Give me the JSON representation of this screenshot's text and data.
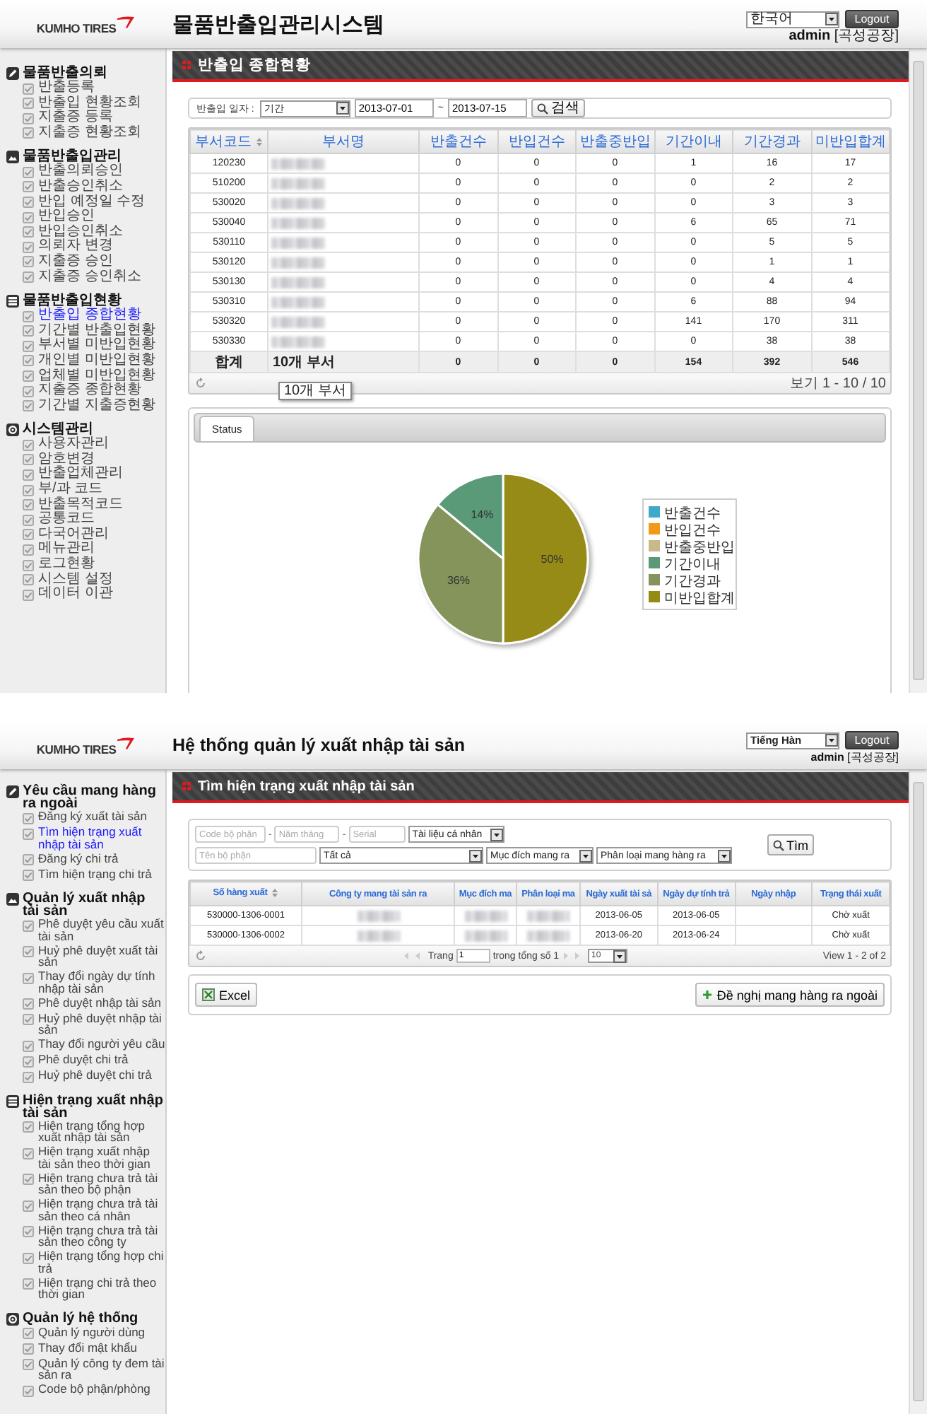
{
  "screens": [
    {
      "kind": "summary",
      "header": {
        "logo": "KUMHO TIRES",
        "title": "물품반출입관리시스템",
        "language": "한국어",
        "logout": "Logout",
        "user": "**admin** [곡성공장]"
      },
      "sidebar": [
        {
          "title": "물품반출의뢰",
          "items": [
            {
              "label": "반출등록",
              "selected": false
            },
            {
              "label": "반출입 현황조회",
              "selected": false
            },
            {
              "label": "지출증 등록",
              "selected": false
            },
            {
              "label": "지출증 현황조회",
              "selected": false
            }
          ]
        },
        {
          "title": "물품반출입관리",
          "items": [
            {
              "label": "반출의뢰승인",
              "selected": false
            },
            {
              "label": "반출승인취소",
              "selected": false
            },
            {
              "label": "반입 예정일 수정",
              "selected": false
            },
            {
              "label": "반입승인",
              "selected": false
            },
            {
              "label": "반입승인취소",
              "selected": false
            },
            {
              "label": "의뢰자 변경",
              "selected": false
            },
            {
              "label": "지출증 승인",
              "selected": false
            },
            {
              "label": "지출증 승인취소",
              "selected": false
            }
          ]
        },
        {
          "title": "물품반출입현황",
          "items": [
            {
              "label": "반출입 종합현황",
              "selected": true
            },
            {
              "label": "기간별 반출입현황",
              "selected": false
            },
            {
              "label": "부서별 미반입현황",
              "selected": false
            },
            {
              "label": "개인별 미반입현황",
              "selected": false
            },
            {
              "label": "업체별 미반입현황",
              "selected": false
            },
            {
              "label": "지출증 종합현황",
              "selected": false
            },
            {
              "label": "기간별 지출증현황",
              "selected": false
            }
          ]
        },
        {
          "title": "시스템관리",
          "items": [
            {
              "label": "사용자관리",
              "selected": false
            },
            {
              "label": "암호변경",
              "selected": false
            },
            {
              "label": "반출업체관리",
              "selected": false
            },
            {
              "label": "부/과 코드",
              "selected": false
            },
            {
              "label": "반출목적코드",
              "selected": false
            },
            {
              "label": "공통코드",
              "selected": false
            },
            {
              "label": "다국어관리",
              "selected": false
            },
            {
              "label": "메뉴관리",
              "selected": false
            },
            {
              "label": "로그현황",
              "selected": false
            },
            {
              "label": "시스템 설정",
              "selected": false
            },
            {
              "label": "데이터 이관",
              "selected": false
            }
          ]
        }
      ],
      "page_title": "반출입 종합현황",
      "filter": {
        "label": "반출입 일자 :",
        "period": "기간",
        "from": "2013-07-01",
        "separator": "~",
        "to": "2013-07-15",
        "search": "검색"
      },
      "table": {
        "columns": [
          {
            "label": "부서코드",
            "sorted": true
          },
          {
            "label": "부서명",
            "sorted": false
          },
          {
            "label": "반출건수",
            "sorted": false
          },
          {
            "label": "반입건수",
            "sorted": false
          },
          {
            "label": "반출중반입",
            "sorted": false
          },
          {
            "label": "기간이내",
            "sorted": false
          },
          {
            "label": "기간경과",
            "sorted": false
          },
          {
            "label": "미반입합계",
            "sorted": false
          }
        ],
        "rows": [
          [
            "120230",
            {
              "kind": "redacted"
            },
            "0",
            "0",
            "0",
            "1",
            "16",
            "17"
          ],
          [
            "510200",
            {
              "kind": "redacted"
            },
            "0",
            "0",
            "0",
            "0",
            "2",
            "2"
          ],
          [
            "530020",
            {
              "kind": "redacted"
            },
            "0",
            "0",
            "0",
            "0",
            "3",
            "3"
          ],
          [
            "530040",
            {
              "kind": "redacted"
            },
            "0",
            "0",
            "0",
            "6",
            "65",
            "71"
          ],
          [
            "530110",
            {
              "kind": "redacted"
            },
            "0",
            "0",
            "0",
            "0",
            "5",
            "5"
          ],
          [
            "530120",
            {
              "kind": "redacted"
            },
            "0",
            "0",
            "0",
            "0",
            "1",
            "1"
          ],
          [
            "530130",
            {
              "kind": "redacted"
            },
            "0",
            "0",
            "0",
            "0",
            "4",
            "4"
          ],
          [
            "530310",
            {
              "kind": "redacted"
            },
            "0",
            "0",
            "0",
            "6",
            "88",
            "94"
          ],
          [
            "530320",
            {
              "kind": "redacted"
            },
            "0",
            "0",
            "0",
            "141",
            "170",
            "311"
          ],
          [
            "530330",
            {
              "kind": "redacted"
            },
            "0",
            "0",
            "0",
            "0",
            "38",
            "38"
          ]
        ],
        "footer": [
          "합계",
          "10개 부서",
          "0",
          "0",
          "0",
          "154",
          "392",
          "546"
        ],
        "tooltip": "10개 부서",
        "pager": {
          "info": "보기 1 - 10 / 10"
        }
      },
      "chart_panel": {
        "tabs": [
          {
            "label": "Status",
            "selected": true
          }
        ],
        "chart_data": {
          "type": "pie",
          "categories": [
            "반출건수",
            "반입건수",
            "반출중반입",
            "기간이내",
            "기간경과",
            "미반입합계"
          ],
          "values": [
            0,
            0,
            0,
            14,
            36,
            50
          ],
          "colors": [
            "#3fa9c9",
            "#f09a1a",
            "#c8b98a",
            "#5a9a78",
            "#84945a",
            "#958b12"
          ],
          "value_labels": [
            null,
            null,
            null,
            "14%",
            "36%",
            "50%"
          ],
          "legend": "right"
        }
      }
    },
    {
      "kind": "search",
      "header": {
        "logo": "KUMHO TIRES",
        "title": "Hệ thống quản lý xuất nhập tài sản",
        "language": "Tiếng Hàn",
        "logout": "Logout",
        "user": "**admin** [곡성공장]"
      },
      "sidebar": [
        {
          "title": "Yêu cầu mang hàng ra ngoài",
          "items": [
            {
              "label": "Đăng ký xuất tài sản",
              "selected": false
            },
            {
              "label": "Tìm hiện trạng xuất nhập tài sản",
              "selected": true
            },
            {
              "label": "Đăng ký chi trả",
              "selected": false
            },
            {
              "label": "Tìm hiện trạng chi trả",
              "selected": false
            }
          ]
        },
        {
          "title": "Quản lý xuất nhập tài sản",
          "items": [
            {
              "label": "Phê duyệt yêu cầu xuất tài sản",
              "selected": false
            },
            {
              "label": "Huỷ phê duyệt xuất tài sản",
              "selected": false
            },
            {
              "label": "Thay đổi ngày dự tính nhập tài sản",
              "selected": false
            },
            {
              "label": "Phê duyệt nhập tài sản",
              "selected": false
            },
            {
              "label": "Huỷ phê duyệt nhập tài sản",
              "selected": false
            },
            {
              "label": "Thay đổi người yêu cầu",
              "selected": false
            },
            {
              "label": "Phê duyệt chi trả",
              "selected": false
            },
            {
              "label": "Huỷ phê duyệt chi trả",
              "selected": false
            }
          ]
        },
        {
          "title": "Hiện trạng xuất nhập tài sản",
          "items": [
            {
              "label": "Hiện trạng tổng hợp xuất nhập tài sản",
              "selected": false
            },
            {
              "label": "Hiện trạng xuất nhập tài sản theo thời gian",
              "selected": false
            },
            {
              "label": "Hiện trạng chưa trả tài sản theo bộ phận",
              "selected": false
            },
            {
              "label": "Hiện trạng chưa trả tài sản theo cá nhân",
              "selected": false
            },
            {
              "label": "Hiện trạng chưa trả tài sản theo công ty",
              "selected": false
            },
            {
              "label": "Hiện trạng tổng hợp chi trả",
              "selected": false
            },
            {
              "label": "Hiện trạng chi trả theo thời gian",
              "selected": false
            }
          ]
        },
        {
          "title": "Quản lý hệ thống",
          "items": [
            {
              "label": "Quản lý người dùng",
              "selected": false
            },
            {
              "label": "Thay đổi mật khẩu",
              "selected": false
            },
            {
              "label": "Quản lý công ty đem tài sản ra",
              "selected": false
            },
            {
              "label": "Code bộ phận/phòng",
              "selected": false
            }
          ]
        }
      ],
      "page_title": "Tìm hiện trạng xuất nhập tài sản",
      "filters": {
        "lines": [
          {
            "fields": [
              {
                "kind": "input",
                "placeholder": "Code bộ phận"
              },
              {
                "kind": "separator",
                "text": "-"
              },
              {
                "kind": "input",
                "placeholder": "Năm tháng"
              },
              {
                "kind": "separator",
                "text": "-"
              },
              {
                "kind": "input",
                "placeholder": "Serial"
              },
              {
                "kind": "select",
                "value": "Tài liệu cá nhân"
              }
            ]
          },
          {
            "fields": [
              {
                "kind": "input",
                "placeholder": "Tên bộ phận"
              },
              {
                "kind": "select",
                "value": "Tất cả"
              },
              {
                "kind": "select",
                "value": "Mục đích mang ra"
              },
              {
                "kind": "select",
                "value": "Phân loại mang hàng ra"
              }
            ]
          }
        ],
        "search": "Tìm"
      },
      "table": {
        "columns": [
          {
            "label": "Số hàng xuất",
            "sorted": true
          },
          {
            "label": "Công ty mang tài sản ra",
            "sorted": false
          },
          {
            "label": "Mục đích ma",
            "sorted": false
          },
          {
            "label": "Phân loại ma",
            "sorted": false
          },
          {
            "label": "Ngày xuất tài sả",
            "sorted": false
          },
          {
            "label": "Ngày dự tính trả",
            "sorted": false
          },
          {
            "label": "Ngày nhập",
            "sorted": false
          },
          {
            "label": "Trạng thái xuất",
            "sorted": false
          }
        ],
        "rows": [
          [
            "530000-1306-0001",
            {
              "kind": "redacted"
            },
            {
              "kind": "redacted"
            },
            {
              "kind": "redacted"
            },
            "2013-06-05",
            "2013-06-05",
            null,
            "Chờ xuất"
          ],
          [
            "530000-1306-0002",
            {
              "kind": "redacted"
            },
            {
              "kind": "redacted"
            },
            {
              "kind": "redacted"
            },
            "2013-06-20",
            "2013-06-24",
            null,
            "Chờ xuất"
          ]
        ],
        "pager": {
          "page_label": "Trang",
          "page": "1",
          "total": "trong tổng số 1",
          "page_size": "10",
          "info": "View 1 - 2 of 2"
        }
      },
      "actions": {
        "excel": "Excel",
        "request": "Đề nghị mang hàng ra ngoài"
      }
    }
  ]
}
